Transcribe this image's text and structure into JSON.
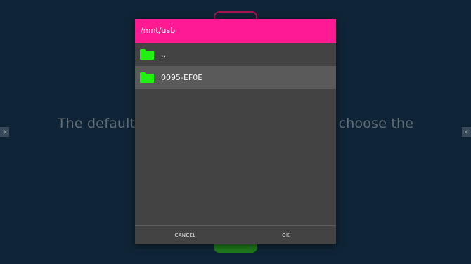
{
  "background": {
    "message_left": "The default f",
    "message_right": "e choose the",
    "left_arrow_glyph": "»",
    "right_arrow_glyph": "«"
  },
  "dialog": {
    "path": "/mnt/usb",
    "header_color": "#fd1a92",
    "folder_icon": "folder-icon",
    "folder_color": "#22ef12",
    "items": [
      {
        "label": "..",
        "selected": false
      },
      {
        "label": "0095-EF0E",
        "selected": true
      }
    ],
    "cancel_label": "CANCEL",
    "ok_label": "OK"
  }
}
